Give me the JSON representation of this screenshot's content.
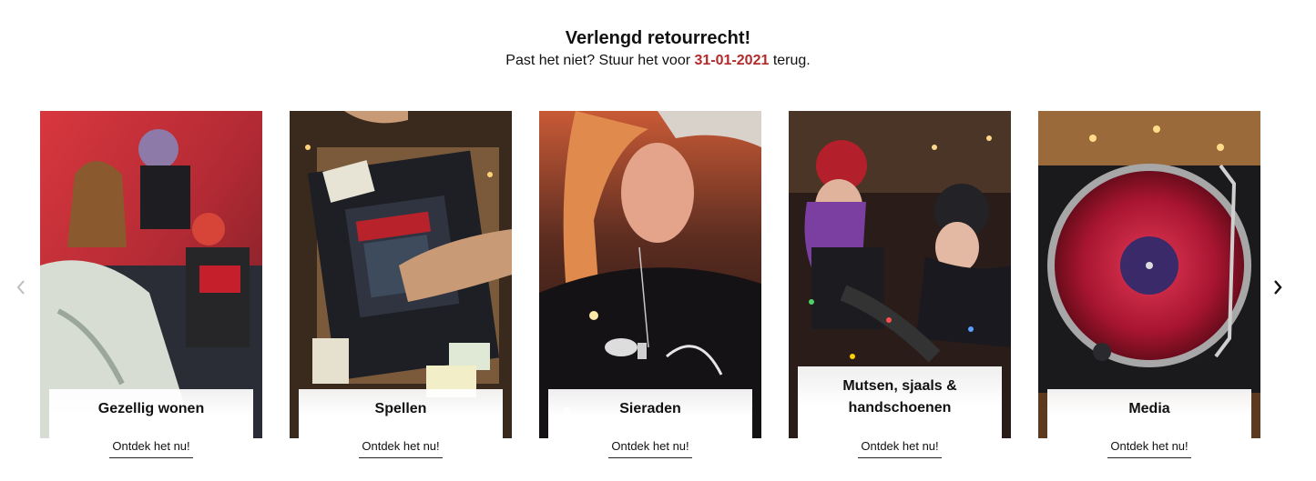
{
  "promo": {
    "title": "Verlengd retourrecht!",
    "subtitle_before": "Past het niet? Stuur het voor",
    "date": "31-01-2021",
    "subtitle_after": "terug."
  },
  "carousel": {
    "prev_icon": "chevron-left-icon",
    "next_icon": "chevron-right-icon",
    "cards": [
      {
        "title": "Gezellig wonen",
        "cta": "Ontdek het nu!",
        "image": "people-on-couch-photo"
      },
      {
        "title": "Spellen",
        "cta": "Ontdek het nu!",
        "image": "board-game-photo"
      },
      {
        "title": "Sieraden",
        "cta": "Ontdek het nu!",
        "image": "necklace-photo"
      },
      {
        "title": "Mutsen, sjaals & handschoenen",
        "cta": "Ontdek het nu!",
        "image": "beanies-photo"
      },
      {
        "title": "Media",
        "cta": "Ontdek het nu!",
        "image": "vinyl-record-photo"
      }
    ]
  },
  "colors": {
    "accent_date": "#b22a2a",
    "text": "#111111"
  }
}
